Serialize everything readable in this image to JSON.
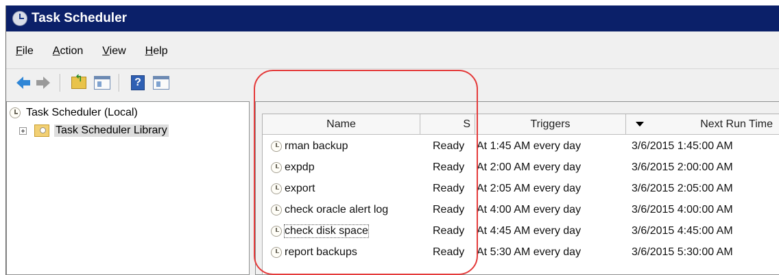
{
  "window": {
    "title": "Task Scheduler"
  },
  "menubar": {
    "items": [
      {
        "mnemonic": "F",
        "rest": "ile"
      },
      {
        "mnemonic": "A",
        "rest": "ction"
      },
      {
        "mnemonic": "V",
        "rest": "iew"
      },
      {
        "mnemonic": "H",
        "rest": "elp"
      }
    ]
  },
  "toolbar": {
    "icons": [
      "back-arrow-icon",
      "forward-arrow-icon",
      "up-folder-icon",
      "show-hide-console-tree-icon",
      "help-icon",
      "show-hide-action-pane-icon"
    ],
    "help_glyph": "?"
  },
  "tree": {
    "root": "Task Scheduler (Local)",
    "library": "Task Scheduler Library"
  },
  "list": {
    "columns": {
      "name": "Name",
      "status": "S",
      "triggers": "Triggers",
      "next_run": "Next Run Time"
    },
    "rows": [
      {
        "name": "rman backup",
        "status": "Ready",
        "trigger": "At 1:45 AM every day",
        "next": "3/6/2015 1:45:00 AM"
      },
      {
        "name": "expdp",
        "status": "Ready",
        "trigger": "At 2:00 AM every day",
        "next": "3/6/2015 2:00:00 AM"
      },
      {
        "name": "export",
        "status": "Ready",
        "trigger": "At 2:05 AM every day",
        "next": "3/6/2015 2:05:00 AM"
      },
      {
        "name": "check oracle alert log",
        "status": "Ready",
        "trigger": "At 4:00 AM every day",
        "next": "3/6/2015 4:00:00 AM"
      },
      {
        "name": "check disk space",
        "status": "Ready",
        "trigger": "At 4:45 AM every day",
        "next": "3/6/2015 4:45:00 AM"
      },
      {
        "name": "report backups",
        "status": "Ready",
        "trigger": "At 5:30 AM every day",
        "next": "3/6/2015 5:30:00 AM"
      }
    ]
  },
  "colors": {
    "titlebar": "#0b2069",
    "annotation": "#e43a3a",
    "chrome": "#f0f0f0"
  }
}
